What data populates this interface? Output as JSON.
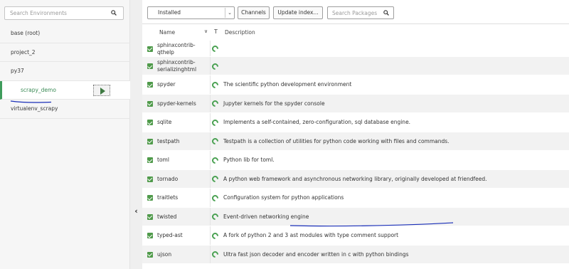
{
  "environments": {
    "search_placeholder": "Search Environments",
    "items": [
      {
        "label": "base (root)"
      },
      {
        "label": "project_2"
      },
      {
        "label": "py37"
      },
      {
        "label": "scrapy_demo"
      },
      {
        "label": "virtualenv_scrapy"
      }
    ],
    "active_index": 3
  },
  "collapse_glyph": "‹",
  "toolbar": {
    "filter_value": "Installed",
    "filter_arrow": "⌄",
    "channels_label": "Channels",
    "update_index_label": "Update index...",
    "search_placeholder": "Search Packages"
  },
  "table": {
    "headers": {
      "name": "Name",
      "sort_glyph": "∨",
      "type_glyph": "T",
      "description": "Description"
    },
    "rows": [
      {
        "name": "sphinxcontrib-qthelp",
        "description": ""
      },
      {
        "name": "sphinxcontrib-serializinghtml",
        "description": ""
      },
      {
        "name": "spyder",
        "description": "The scientific python development environment"
      },
      {
        "name": "spyder-kernels",
        "description": "Jupyter kernels for the spyder console"
      },
      {
        "name": "sqlite",
        "description": "Implements a self-contained, zero-configuration, sql database engine."
      },
      {
        "name": "testpath",
        "description": "Testpath is a collection of utilities for python code working with files and commands."
      },
      {
        "name": "toml",
        "description": "Python lib for toml."
      },
      {
        "name": "tornado",
        "description": "A python web framework and asynchronous networking library, originally developed at friendfeed."
      },
      {
        "name": "traitlets",
        "description": "Configuration system for python applications"
      },
      {
        "name": "twisted",
        "description": "Event-driven networking engine"
      },
      {
        "name": "typed-ast",
        "description": "A fork of python 2 and 3 ast modules with type comment support"
      },
      {
        "name": "ujson",
        "description": "Ultra fast json decoder and encoder written in c with python bindings"
      }
    ]
  },
  "colors": {
    "accent_green": "#3f9c5c",
    "annotation_blue": "#1a2fb8"
  },
  "icons": [
    "search-icon",
    "play-icon",
    "chevron-left-icon",
    "dropdown-arrow-icon",
    "checkbox-checked-icon",
    "status-installed-icon"
  ]
}
